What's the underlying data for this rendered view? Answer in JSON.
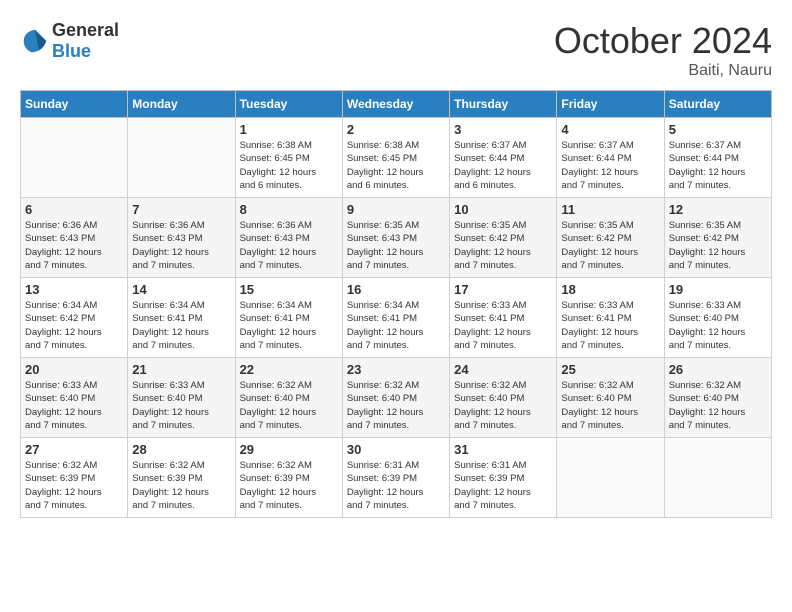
{
  "logo": {
    "text_general": "General",
    "text_blue": "Blue"
  },
  "header": {
    "month": "October 2024",
    "location": "Baiti, Nauru"
  },
  "weekdays": [
    "Sunday",
    "Monday",
    "Tuesday",
    "Wednesday",
    "Thursday",
    "Friday",
    "Saturday"
  ],
  "weeks": [
    [
      {
        "day": "",
        "info": ""
      },
      {
        "day": "",
        "info": ""
      },
      {
        "day": "1",
        "info": "Sunrise: 6:38 AM\nSunset: 6:45 PM\nDaylight: 12 hours\nand 6 minutes."
      },
      {
        "day": "2",
        "info": "Sunrise: 6:38 AM\nSunset: 6:45 PM\nDaylight: 12 hours\nand 6 minutes."
      },
      {
        "day": "3",
        "info": "Sunrise: 6:37 AM\nSunset: 6:44 PM\nDaylight: 12 hours\nand 6 minutes."
      },
      {
        "day": "4",
        "info": "Sunrise: 6:37 AM\nSunset: 6:44 PM\nDaylight: 12 hours\nand 7 minutes."
      },
      {
        "day": "5",
        "info": "Sunrise: 6:37 AM\nSunset: 6:44 PM\nDaylight: 12 hours\nand 7 minutes."
      }
    ],
    [
      {
        "day": "6",
        "info": "Sunrise: 6:36 AM\nSunset: 6:43 PM\nDaylight: 12 hours\nand 7 minutes."
      },
      {
        "day": "7",
        "info": "Sunrise: 6:36 AM\nSunset: 6:43 PM\nDaylight: 12 hours\nand 7 minutes."
      },
      {
        "day": "8",
        "info": "Sunrise: 6:36 AM\nSunset: 6:43 PM\nDaylight: 12 hours\nand 7 minutes."
      },
      {
        "day": "9",
        "info": "Sunrise: 6:35 AM\nSunset: 6:43 PM\nDaylight: 12 hours\nand 7 minutes."
      },
      {
        "day": "10",
        "info": "Sunrise: 6:35 AM\nSunset: 6:42 PM\nDaylight: 12 hours\nand 7 minutes."
      },
      {
        "day": "11",
        "info": "Sunrise: 6:35 AM\nSunset: 6:42 PM\nDaylight: 12 hours\nand 7 minutes."
      },
      {
        "day": "12",
        "info": "Sunrise: 6:35 AM\nSunset: 6:42 PM\nDaylight: 12 hours\nand 7 minutes."
      }
    ],
    [
      {
        "day": "13",
        "info": "Sunrise: 6:34 AM\nSunset: 6:42 PM\nDaylight: 12 hours\nand 7 minutes."
      },
      {
        "day": "14",
        "info": "Sunrise: 6:34 AM\nSunset: 6:41 PM\nDaylight: 12 hours\nand 7 minutes."
      },
      {
        "day": "15",
        "info": "Sunrise: 6:34 AM\nSunset: 6:41 PM\nDaylight: 12 hours\nand 7 minutes."
      },
      {
        "day": "16",
        "info": "Sunrise: 6:34 AM\nSunset: 6:41 PM\nDaylight: 12 hours\nand 7 minutes."
      },
      {
        "day": "17",
        "info": "Sunrise: 6:33 AM\nSunset: 6:41 PM\nDaylight: 12 hours\nand 7 minutes."
      },
      {
        "day": "18",
        "info": "Sunrise: 6:33 AM\nSunset: 6:41 PM\nDaylight: 12 hours\nand 7 minutes."
      },
      {
        "day": "19",
        "info": "Sunrise: 6:33 AM\nSunset: 6:40 PM\nDaylight: 12 hours\nand 7 minutes."
      }
    ],
    [
      {
        "day": "20",
        "info": "Sunrise: 6:33 AM\nSunset: 6:40 PM\nDaylight: 12 hours\nand 7 minutes."
      },
      {
        "day": "21",
        "info": "Sunrise: 6:33 AM\nSunset: 6:40 PM\nDaylight: 12 hours\nand 7 minutes."
      },
      {
        "day": "22",
        "info": "Sunrise: 6:32 AM\nSunset: 6:40 PM\nDaylight: 12 hours\nand 7 minutes."
      },
      {
        "day": "23",
        "info": "Sunrise: 6:32 AM\nSunset: 6:40 PM\nDaylight: 12 hours\nand 7 minutes."
      },
      {
        "day": "24",
        "info": "Sunrise: 6:32 AM\nSunset: 6:40 PM\nDaylight: 12 hours\nand 7 minutes."
      },
      {
        "day": "25",
        "info": "Sunrise: 6:32 AM\nSunset: 6:40 PM\nDaylight: 12 hours\nand 7 minutes."
      },
      {
        "day": "26",
        "info": "Sunrise: 6:32 AM\nSunset: 6:40 PM\nDaylight: 12 hours\nand 7 minutes."
      }
    ],
    [
      {
        "day": "27",
        "info": "Sunrise: 6:32 AM\nSunset: 6:39 PM\nDaylight: 12 hours\nand 7 minutes."
      },
      {
        "day": "28",
        "info": "Sunrise: 6:32 AM\nSunset: 6:39 PM\nDaylight: 12 hours\nand 7 minutes."
      },
      {
        "day": "29",
        "info": "Sunrise: 6:32 AM\nSunset: 6:39 PM\nDaylight: 12 hours\nand 7 minutes."
      },
      {
        "day": "30",
        "info": "Sunrise: 6:31 AM\nSunset: 6:39 PM\nDaylight: 12 hours\nand 7 minutes."
      },
      {
        "day": "31",
        "info": "Sunrise: 6:31 AM\nSunset: 6:39 PM\nDaylight: 12 hours\nand 7 minutes."
      },
      {
        "day": "",
        "info": ""
      },
      {
        "day": "",
        "info": ""
      }
    ]
  ]
}
